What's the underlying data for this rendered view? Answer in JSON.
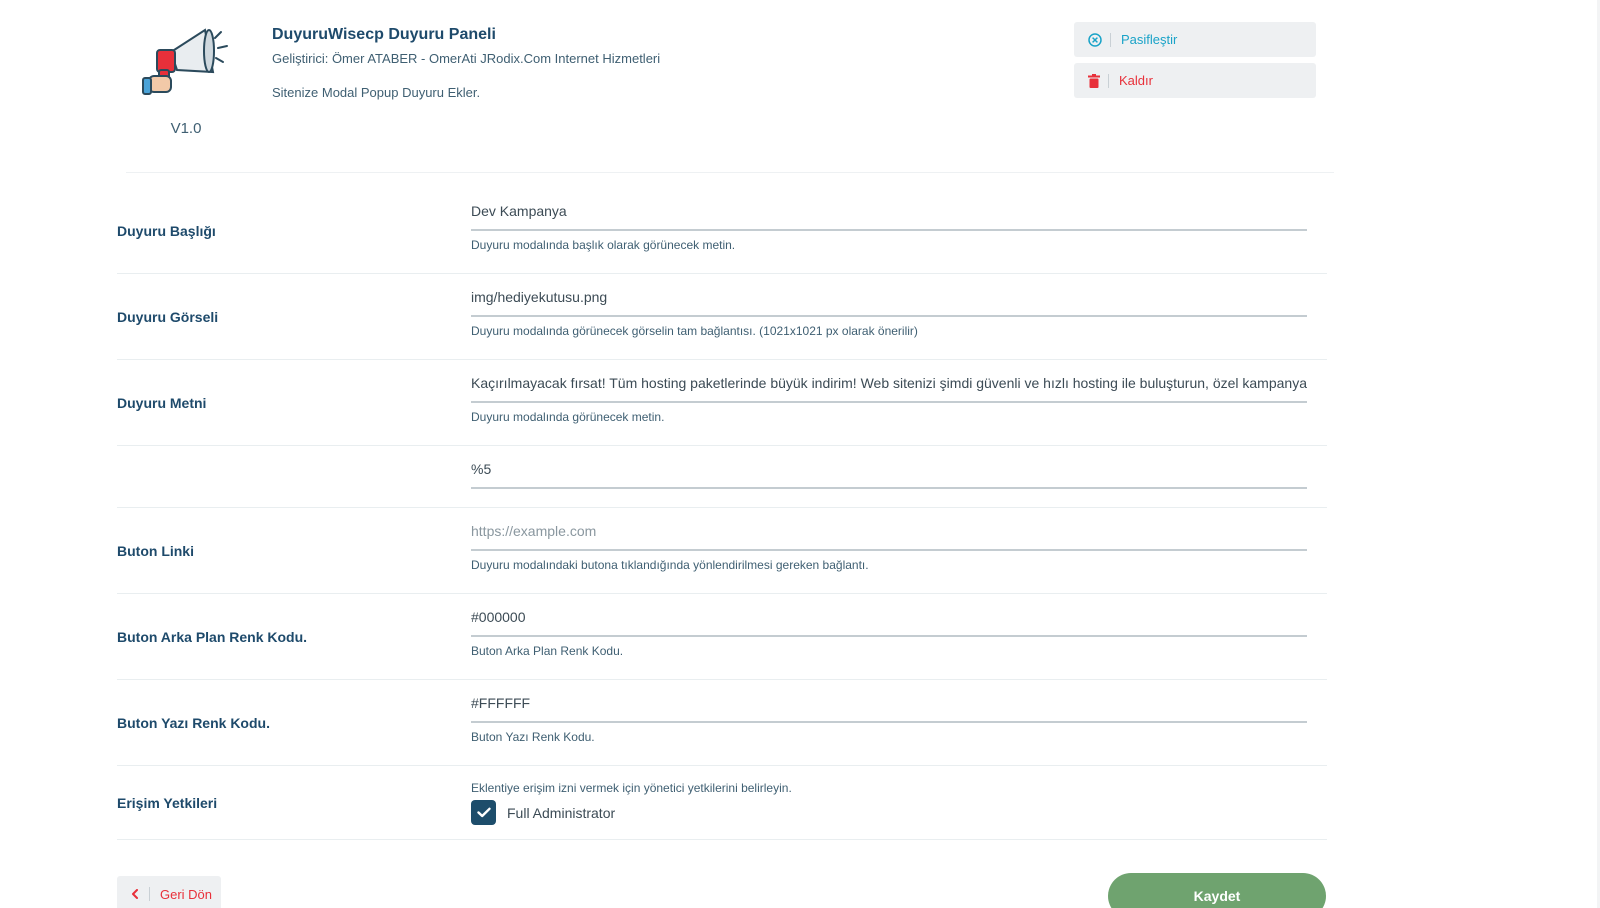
{
  "plugin": {
    "title": "DuyuruWisecp Duyuru Paneli",
    "developer": "Geliştirici: Ömer ATABER - OmerAti JRodix.Com Internet Hizmetleri",
    "description": "Sitenize Modal Popup Duyuru Ekler.",
    "version": "V1.0",
    "logo_icon": "megaphone-icon"
  },
  "actions": {
    "deactivate_label": "Pasifleştir",
    "deactivate_icon": "circle-x-icon",
    "remove_label": "Kaldır",
    "remove_icon": "trash-icon"
  },
  "form": {
    "title": {
      "label": "Duyuru Başlığı",
      "value": "Dev Kampanya",
      "hint": "Duyuru modalında başlık olarak görünecek metin."
    },
    "image": {
      "label": "Duyuru Görseli",
      "value": "img/hediyekutusu.png",
      "hint": "Duyuru modalında görünecek görselin tam bağlantısı. (1021x1021 px olarak önerilir)"
    },
    "text": {
      "label": "Duyuru Metni",
      "value": "Kaçırılmayacak fırsat! Tüm hosting paketlerinde büyük indirim! Web sitenizi şimdi güvenli ve hızlı hosting ile buluşturun, özel kampanya",
      "hint": "Duyuru modalında görünecek metin."
    },
    "extra": {
      "label": "",
      "value": "%5"
    },
    "button_link": {
      "label": "Buton Linki",
      "placeholder": "https://example.com",
      "hint": "Duyuru modalındaki butona tıklandığında yönlendirilmesi gereken bağlantı."
    },
    "button_bg": {
      "label": "Buton Arka Plan Renk Kodu.",
      "value": "#000000",
      "hint": "Buton Arka Plan Renk Kodu."
    },
    "button_text_color": {
      "label": "Buton Yazı Renk Kodu.",
      "value": "#FFFFFF",
      "hint": "Buton Yazı Renk Kodu."
    },
    "access": {
      "label": "Erişim Yetkileri",
      "hint": "Eklentiye erişim izni vermek için yönetici yetkilerini belirleyin.",
      "option_label": "Full Administrator",
      "checked": true
    }
  },
  "footer": {
    "back_label": "Geri Dön",
    "save_label": "Kaydet"
  },
  "colors": {
    "primary": "#1e4a6b",
    "deactivate": "#1aa3c8",
    "danger": "#e8303a",
    "save": "#6fa36f"
  }
}
